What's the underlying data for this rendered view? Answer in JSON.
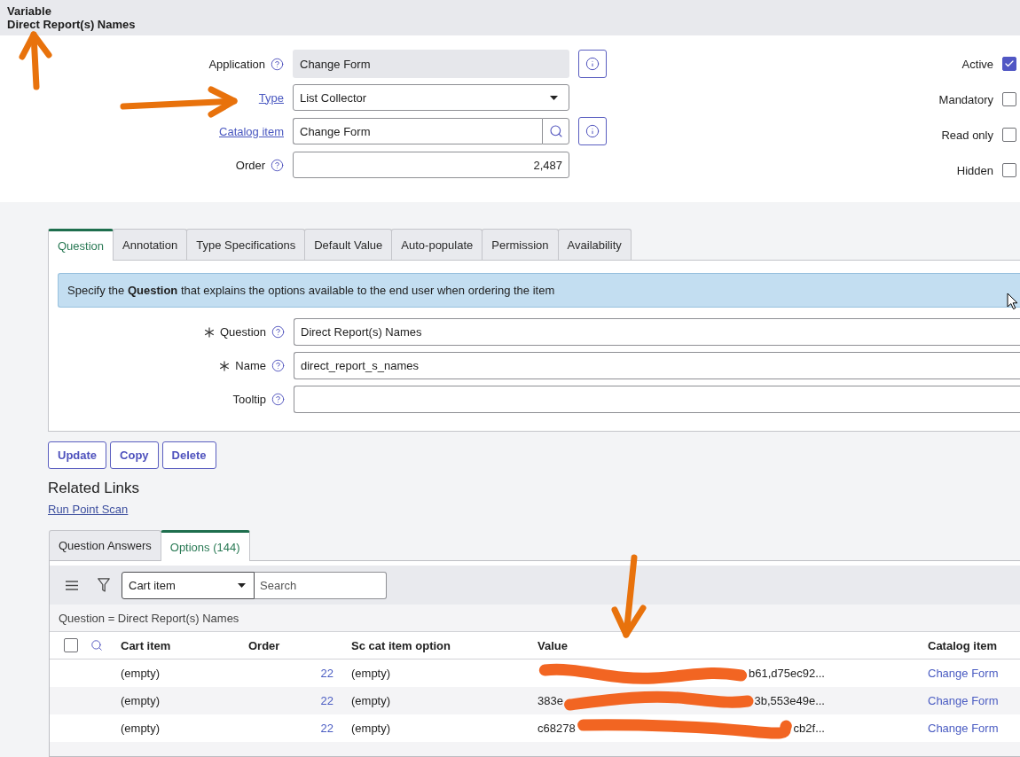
{
  "header": {
    "title": "Variable",
    "subtitle": "Direct Report(s) Names"
  },
  "form": {
    "fields": [
      {
        "label": "Application",
        "kind": "readonly",
        "value": "Change Form",
        "link": false,
        "help": true,
        "info_button": true
      },
      {
        "label": "Type",
        "kind": "select",
        "value": "List Collector",
        "link": true,
        "help": false,
        "info_button": false
      },
      {
        "label": "Catalog item",
        "kind": "reference",
        "value": "Change Form",
        "link": true,
        "help": false,
        "info_button": true
      },
      {
        "label": "Order",
        "kind": "number",
        "value": "2,487",
        "link": false,
        "help": true,
        "info_button": false
      }
    ],
    "flags": [
      {
        "label": "Active",
        "checked": true
      },
      {
        "label": "Mandatory",
        "checked": false
      },
      {
        "label": "Read only",
        "checked": false
      },
      {
        "label": "Hidden",
        "checked": false
      }
    ]
  },
  "tabs": [
    {
      "label": "Question",
      "selected": true
    },
    {
      "label": "Annotation",
      "selected": false
    },
    {
      "label": "Type Specifications",
      "selected": false
    },
    {
      "label": "Default Value",
      "selected": false
    },
    {
      "label": "Auto-populate",
      "selected": false
    },
    {
      "label": "Permission",
      "selected": false
    },
    {
      "label": "Availability",
      "selected": false
    }
  ],
  "question_panel": {
    "banner": "Specify the **Question** that explains the options available to the end user when ordering the item",
    "fields": [
      {
        "label": "Question",
        "required": true,
        "value": "Direct Report(s) Names"
      },
      {
        "label": "Name",
        "required": true,
        "value": "direct_report_s_names"
      },
      {
        "label": "Tooltip",
        "required": false
      }
    ]
  },
  "buttons": [
    "Update",
    "Copy",
    "Delete"
  ],
  "related_links": {
    "title": "Related Links",
    "links": [
      "Run Point Scan"
    ]
  },
  "related_list": {
    "tabs": [
      {
        "label": "Question Answers",
        "selected": false
      },
      {
        "label": "Options (144)",
        "selected": true
      }
    ],
    "filter_field": {
      "value": "Cart item"
    },
    "search": {
      "placeholder": "Search"
    },
    "breadcrumb": "Question = Direct Report(s) Names",
    "select_all": {
      "checked": false
    },
    "columns": [
      "Cart item",
      "Order",
      "Sc cat item option",
      "Value",
      "Catalog item"
    ],
    "rows": [
      {
        "cart_item": "(empty)",
        "order": "22",
        "option": "(empty)",
        "value_end": "b61,d75ec92...",
        "redacted": true,
        "catalog_item": "Change Form"
      },
      {
        "cart_item": "(empty)",
        "order": "22",
        "option": "(empty)",
        "value_start": "383e",
        "value_end": "3b,553e49e...",
        "redacted": true,
        "catalog_item": "Change Form"
      },
      {
        "cart_item": "(empty)",
        "order": "22",
        "option": "(empty)",
        "value_start": "c68278",
        "value_end": "cb2f...",
        "redacted": true,
        "catalog_item": "Change Form"
      }
    ]
  }
}
